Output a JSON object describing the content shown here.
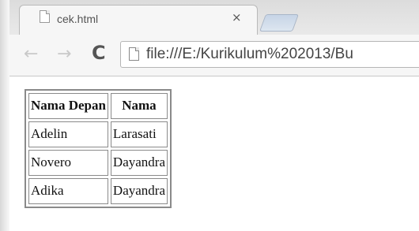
{
  "browser": {
    "tab": {
      "title": "cek.html",
      "close_glyph": "×",
      "icon": "page-icon"
    },
    "toolbar": {
      "back_glyph": "←",
      "forward_glyph": "→",
      "reload_glyph": "C",
      "url": "file:///E:/Kurikulum%202013/Bu"
    }
  },
  "table": {
    "headers": [
      "Nama Depan",
      "Nama"
    ],
    "rows": [
      [
        "Adelin",
        "Larasati"
      ],
      [
        "Novero",
        "Dayandra"
      ],
      [
        "Adika",
        "Dayandra"
      ]
    ]
  }
}
